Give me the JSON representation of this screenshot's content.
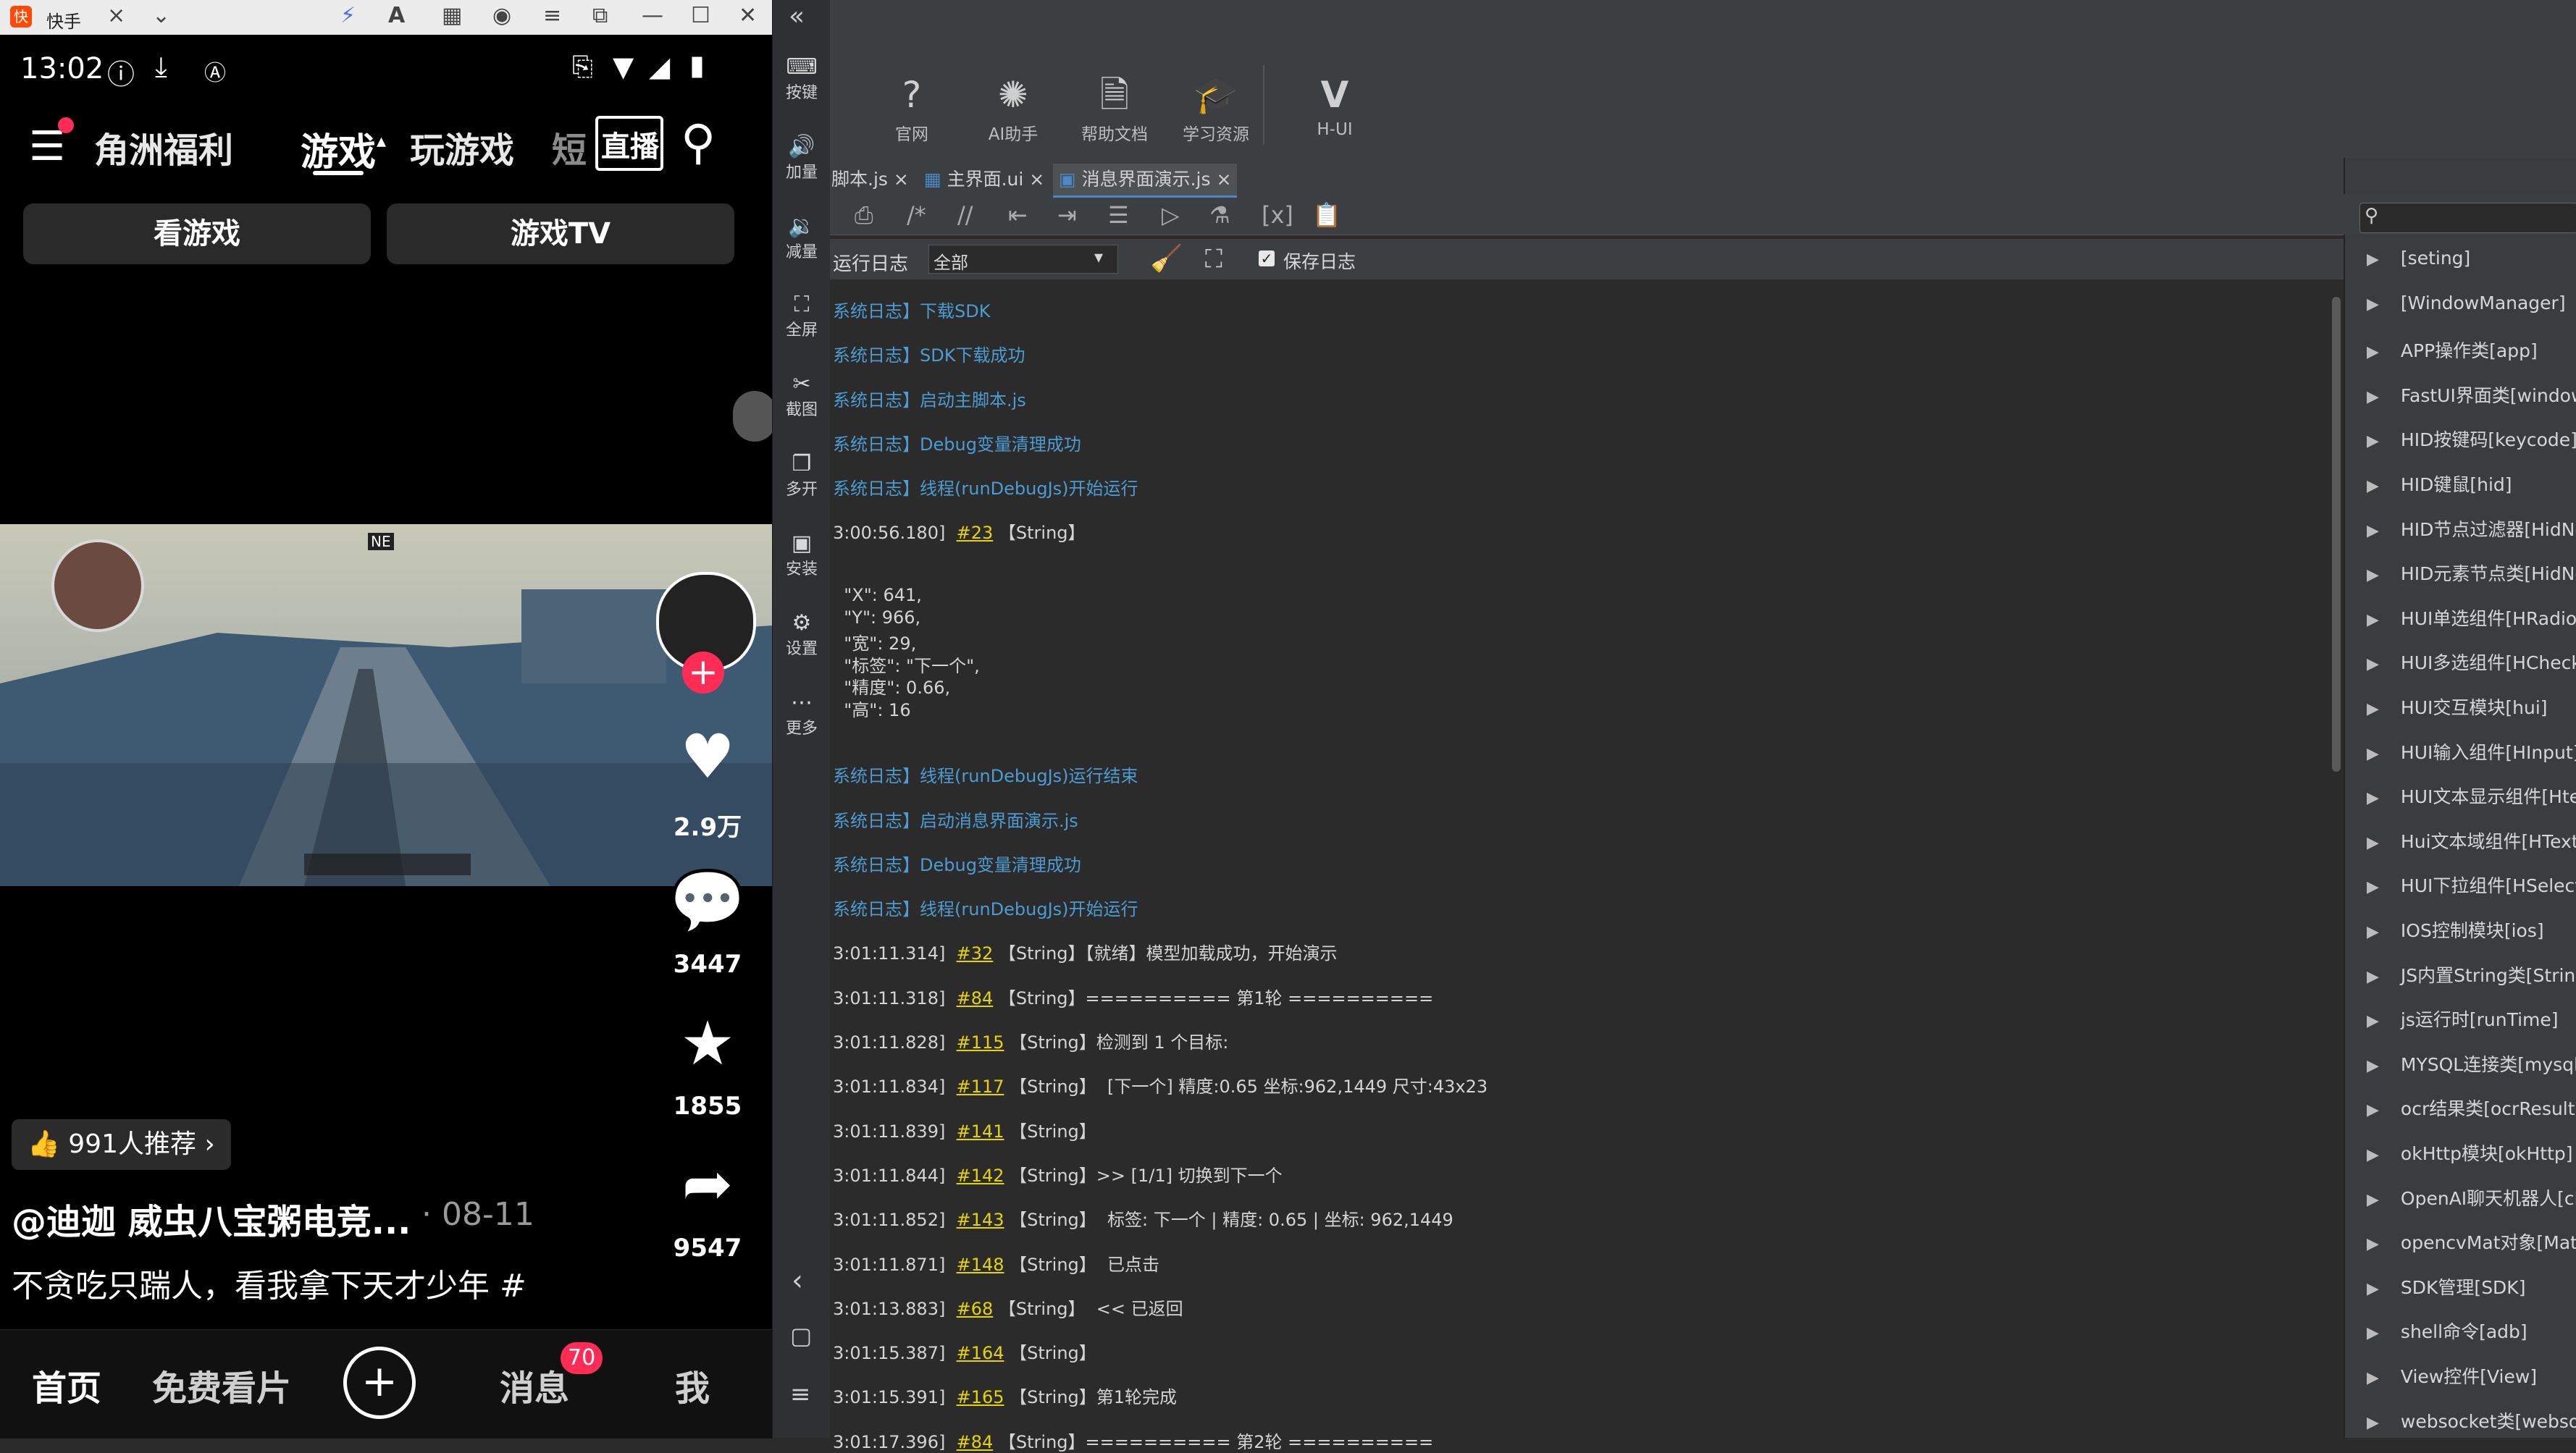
{
  "phone_window": {
    "app_title": "快手",
    "status": {
      "time": "13:02"
    },
    "nav_tabs": [
      "角洲福利",
      "游戏",
      "玩游戏",
      "短",
      "直播"
    ],
    "sub_buttons": [
      "看游戏",
      "游戏TV"
    ],
    "video_hud": {
      "mode_label": "NE"
    },
    "side_counts": {
      "likes": "2.9万",
      "comments": "3447",
      "stars": "1855",
      "shares": "9547"
    },
    "recommend_label": "991人推荐",
    "author_line": "@迪迦 威虫八宝粥电竞...",
    "author_date": "· 08-11",
    "caption": "不贪吃只踹人，看我拿下天才少年 #",
    "bottom_nav": {
      "home": "首页",
      "free": "免费看片",
      "messages": "消息",
      "msg_badge": "70",
      "me": "我"
    }
  },
  "side_toolbar": [
    {
      "icon": "keyboard-icon",
      "glyph": "⌨",
      "label": "按键"
    },
    {
      "icon": "volume-up-icon",
      "glyph": "🔊",
      "label": "加量"
    },
    {
      "icon": "volume-down-icon",
      "glyph": "🔉",
      "label": "减量"
    },
    {
      "icon": "fullscreen-icon",
      "glyph": "⛶",
      "label": "全屏"
    },
    {
      "icon": "scissors-icon",
      "glyph": "✂",
      "label": "截图"
    },
    {
      "icon": "multi-window-icon",
      "glyph": "❐",
      "label": "多开"
    },
    {
      "icon": "apk-icon",
      "glyph": "▣",
      "label": "安装"
    },
    {
      "icon": "settings-icon",
      "glyph": "⚙",
      "label": "设置"
    },
    {
      "icon": "more-icon",
      "glyph": "⋯",
      "label": "更多"
    }
  ],
  "ide_tools": [
    {
      "icon": "help-circle-icon",
      "glyph": "?",
      "label": "官网"
    },
    {
      "icon": "ai-icon",
      "glyph": "✺",
      "label": "AI助手"
    },
    {
      "icon": "document-icon",
      "glyph": "🗎",
      "label": "帮助文档"
    },
    {
      "icon": "graduation-cap-icon",
      "glyph": "🎓",
      "label": "学习资源"
    },
    {
      "icon": "vue-logo-icon",
      "glyph": "V",
      "label": "H-UI"
    }
  ],
  "file_tabs": [
    {
      "label": "脚本.js",
      "active": false
    },
    {
      "label": "主界面.ui",
      "active": false
    },
    {
      "label": "消息界面演示.js",
      "active": true
    }
  ],
  "log_bar": {
    "label": "运行日志",
    "filter_value": "全部",
    "save_log_label": "保存日志",
    "save_log_checked": true
  },
  "log_lines": [
    {
      "kind": "sys",
      "text": "系统日志】下载SDK"
    },
    {
      "kind": "sys",
      "text": "系统日志】SDK下载成功"
    },
    {
      "kind": "sys",
      "text": "系统日志】启动主脚本.js"
    },
    {
      "kind": "sys",
      "text": "系统日志】Debug变量清理成功"
    },
    {
      "kind": "sys",
      "text": "系统日志】线程(runDebugJs)开始运行"
    },
    {
      "kind": "msg",
      "time": "3:00:56.180]",
      "link": "#23",
      "text": "【String】"
    },
    {
      "kind": "plain",
      "text": ""
    },
    {
      "kind": "plain",
      "text": "  \"X\": 641,"
    },
    {
      "kind": "plain",
      "text": "  \"Y\": 966,"
    },
    {
      "kind": "plain",
      "text": "  \"宽\": 29,"
    },
    {
      "kind": "plain",
      "text": "  \"标签\": \"下一个\","
    },
    {
      "kind": "plain",
      "text": "  \"精度\": 0.66,"
    },
    {
      "kind": "plain",
      "text": "  \"高\": 16"
    },
    {
      "kind": "plain",
      "text": ""
    },
    {
      "kind": "plain",
      "text": ""
    },
    {
      "kind": "sys",
      "text": "系统日志】线程(runDebugJs)运行结束"
    },
    {
      "kind": "sys",
      "text": "系统日志】启动消息界面演示.js"
    },
    {
      "kind": "sys",
      "text": "系统日志】Debug变量清理成功"
    },
    {
      "kind": "sys",
      "text": "系统日志】线程(runDebugJs)开始运行"
    },
    {
      "kind": "msg",
      "time": "3:01:11.314]",
      "link": "#32",
      "text": "【String】【就绪】模型加载成功，开始演示"
    },
    {
      "kind": "msg",
      "time": "3:01:11.318]",
      "link": "#84",
      "text": "【String】========== 第1轮 =========="
    },
    {
      "kind": "msg",
      "time": "3:01:11.828]",
      "link": "#115",
      "text": "【String】检测到 1 个目标:"
    },
    {
      "kind": "msg",
      "time": "3:01:11.834]",
      "link": "#117",
      "text": "【String】  [下一个] 精度:0.65 坐标:962,1449 尺寸:43x23"
    },
    {
      "kind": "msg",
      "time": "3:01:11.839]",
      "link": "#141",
      "text": "【String】"
    },
    {
      "kind": "msg",
      "time": "3:01:11.844]",
      "link": "#142",
      "text": "【String】>> [1/1] 切换到下一个"
    },
    {
      "kind": "msg",
      "time": "3:01:11.852]",
      "link": "#143",
      "text": "【String】  标签: 下一个 | 精度: 0.65 | 坐标: 962,1449"
    },
    {
      "kind": "msg",
      "time": "3:01:11.871]",
      "link": "#148",
      "text": "【String】  已点击"
    },
    {
      "kind": "msg",
      "time": "3:01:13.883]",
      "link": "#68",
      "text": "【String】  << 已返回"
    },
    {
      "kind": "msg",
      "time": "3:01:15.387]",
      "link": "#164",
      "text": "【String】"
    },
    {
      "kind": "msg",
      "time": "3:01:15.391]",
      "link": "#165",
      "text": "【String】第1轮完成"
    },
    {
      "kind": "msg",
      "time": "3:01:17.396]",
      "link": "#84",
      "text": "【String】========== 第2轮 =========="
    }
  ],
  "right_panel": {
    "items": [
      "[seting]",
      "[WindowManager]",
      "APP操作类[app]",
      "FastUI界面类[window",
      "HID按键码[keycode]",
      "HID键鼠[hid]",
      "HID节点过滤器[HidNo",
      "HID元素节点类[HidNo",
      "HUI单选组件[HRadio]",
      "HUI多选组件[HCheck",
      "HUI交互模块[hui]",
      "HUI输入组件[HInput]",
      "HUI文本显示组件[Htex",
      "Hui文本域组件[HTextA",
      "HUI下拉组件[HSelect]",
      "IOS控制模块[ios]",
      "JS内置String类[String",
      "js运行时[runTime]",
      "MYSQL连接类[mysql]",
      "ocr结果类[ocrResult]",
      "okHttp模块[okHttp]",
      "OpenAI聊天机器人[ch",
      "opencvMat对象[Mat]",
      "SDK管理[SDK]",
      "shell命令[adb]",
      "View控件[View]",
      "websocket类[websoc"
    ]
  },
  "colors": {
    "log_sys": "#4b9cd3",
    "log_link": "#e6d400",
    "accent": "#ff2d55"
  }
}
